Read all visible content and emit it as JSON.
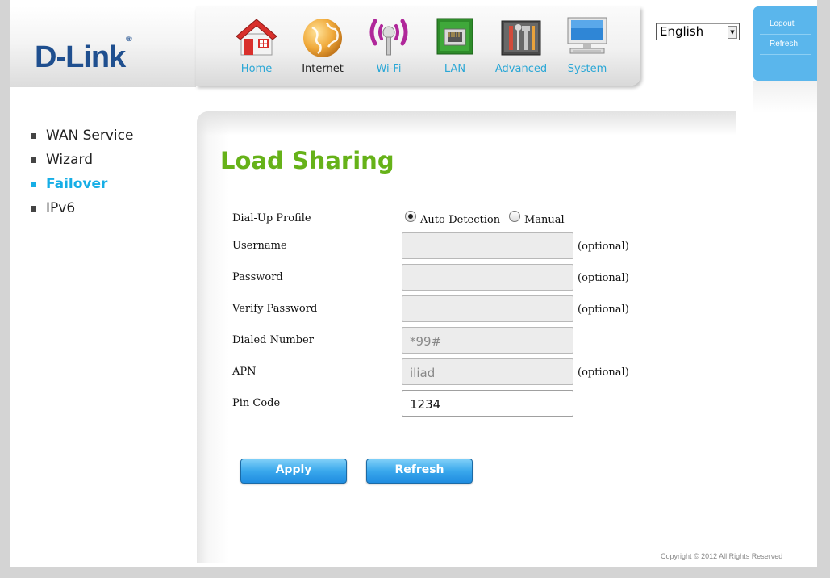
{
  "brand": {
    "logo": "D-Link",
    "registered": "®"
  },
  "nav": [
    {
      "label": "Home",
      "icon": "home-icon"
    },
    {
      "label": "Internet",
      "icon": "globe-icon",
      "active": true
    },
    {
      "label": "Wi-Fi",
      "icon": "wifi-icon"
    },
    {
      "label": "LAN",
      "icon": "lan-icon"
    },
    {
      "label": "Advanced",
      "icon": "tools-icon"
    },
    {
      "label": "System",
      "icon": "monitor-icon"
    }
  ],
  "language": {
    "selected": "English"
  },
  "account": {
    "logout": "Logout",
    "refresh": "Refresh"
  },
  "sidebar": {
    "items": [
      {
        "label": "WAN Service"
      },
      {
        "label": "Wizard"
      },
      {
        "label": "Failover",
        "active": true
      },
      {
        "label": "IPv6"
      }
    ]
  },
  "main": {
    "title": "Load Sharing",
    "dialup": {
      "label": "Dial-Up Profile",
      "options": [
        "Auto-Detection",
        "Manual"
      ],
      "selected": "Auto-Detection"
    },
    "fields": {
      "username": {
        "label": "Username",
        "value": "",
        "note": "(optional)"
      },
      "password": {
        "label": "Password",
        "value": "",
        "note": "(optional)"
      },
      "verify_password": {
        "label": "Verify Password",
        "value": "",
        "note": "(optional)"
      },
      "dialed_number": {
        "label": "Dialed Number",
        "value": "*99#"
      },
      "apn": {
        "label": "APN",
        "value": "iliad",
        "note": "(optional)"
      },
      "pin_code": {
        "label": "Pin Code",
        "value": "1234"
      }
    },
    "buttons": {
      "apply": "Apply",
      "refresh": "Refresh"
    }
  },
  "footer": {
    "copyright": "Copyright © 2012  All Rights Reserved"
  },
  "colors": {
    "accent_blue": "#16aee6",
    "title_green": "#66b219",
    "logo_blue": "#1f4f8f",
    "button_blue": "#2a9be6"
  }
}
